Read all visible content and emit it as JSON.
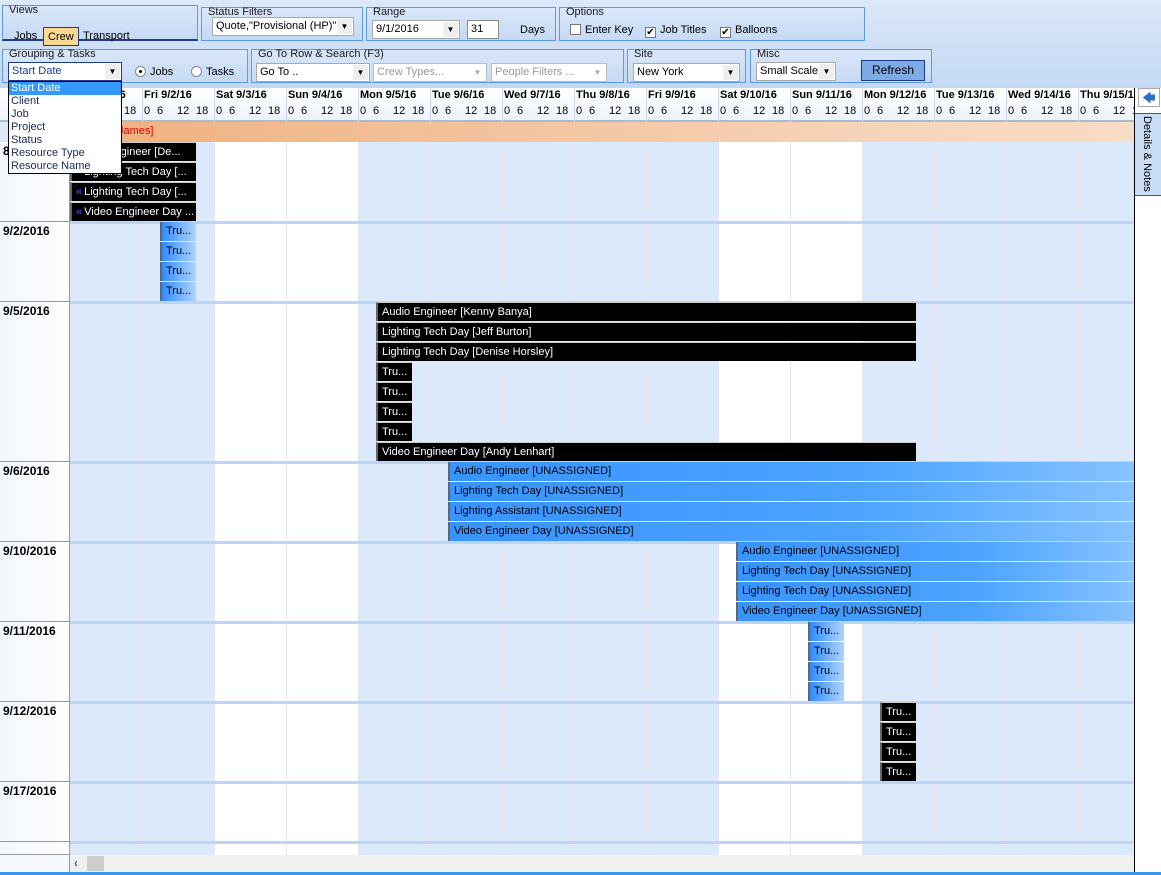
{
  "views": {
    "title": "Views",
    "tabs": [
      {
        "label": "Jobs",
        "active": false
      },
      {
        "label": "Crew",
        "active": true
      },
      {
        "label": "Transport",
        "active": false
      }
    ]
  },
  "status_filters": {
    "title": "Status Filters",
    "value": "Quote,\"Provisional (HP)\","
  },
  "range": {
    "title": "Range",
    "start_date": "9/1/2016",
    "days_value": "31",
    "days_label": "Days"
  },
  "options": {
    "title": "Options",
    "items": [
      {
        "label": "Enter Key",
        "checked": false
      },
      {
        "label": "Job Titles",
        "checked": true
      },
      {
        "label": "Balloons",
        "checked": true
      }
    ]
  },
  "grouping": {
    "title": "Grouping & Tasks",
    "value": "Start Date",
    "radios": [
      {
        "label": "Jobs",
        "selected": true
      },
      {
        "label": "Tasks",
        "selected": false
      }
    ],
    "dropdown_options": [
      "Start Date",
      "Client",
      "Job",
      "Project",
      "Status",
      "Resource Type",
      "Resource Name"
    ],
    "dropdown_selected": "Start Date"
  },
  "goto": {
    "title": "Go To Row & Search (F3)",
    "goto_value": "Go To ..",
    "crew_types_placeholder": "Crew Types...",
    "people_filters_placeholder": "People Filters ..."
  },
  "site": {
    "title": "Site",
    "value": "New York"
  },
  "misc": {
    "title": "Misc",
    "scale_value": "Small Scale",
    "refresh_label": "Refresh"
  },
  "side_panel": {
    "tab_label": "Details & Notes"
  },
  "timeline": {
    "view_start": "2016-09-01",
    "hour_ticks": [
      "0",
      "6",
      "12",
      "18"
    ],
    "days": [
      {
        "label": "Thu 9/1/16",
        "weekend": false
      },
      {
        "label": "Fri 9/2/16",
        "weekend": false
      },
      {
        "label": "Sat 9/3/16",
        "weekend": true
      },
      {
        "label": "Sun 9/4/16",
        "weekend": true
      },
      {
        "label": "Mon 9/5/16",
        "weekend": false
      },
      {
        "label": "Tue 9/6/16",
        "weekend": false
      },
      {
        "label": "Wed 9/7/16",
        "weekend": false
      },
      {
        "label": "Thu 9/8/16",
        "weekend": false
      },
      {
        "label": "Fri 9/9/16",
        "weekend": false
      },
      {
        "label": "Sat 9/10/16",
        "weekend": true
      },
      {
        "label": "Sun 9/11/16",
        "weekend": true
      },
      {
        "label": "Mon 9/12/16",
        "weekend": false
      },
      {
        "label": "Tue 9/13/16",
        "weekend": false
      },
      {
        "label": "Wed 9/14/16",
        "weekend": false
      },
      {
        "label": "Thu 9/15/16",
        "weekend": false
      }
    ]
  },
  "summary_row": {
    "text": "James]"
  },
  "colors": {
    "black_bar": "#000000",
    "unassigned_bar": "#3894ff",
    "weekday_bg": "#dbe9fa",
    "weekend_bg": "#ffffff",
    "summary_row": "#efb07e",
    "summary_text": "#e00000"
  },
  "groups": [
    {
      "label": "8",
      "rows": 4,
      "bars": [
        {
          "text": "Audio Engineer [De...",
          "style": "black",
          "start": "2016-09-01 00:00",
          "end": "2016-09-02 18:00",
          "continues_left": false
        },
        {
          "text": "Lighting Tech Day [...",
          "style": "black",
          "start": "2016-09-01 00:00",
          "end": "2016-09-02 18:00",
          "continues_left": true
        },
        {
          "text": "Lighting Tech Day [...",
          "style": "black",
          "start": "2016-09-01 00:00",
          "end": "2016-09-02 18:00",
          "continues_left": true
        },
        {
          "text": "Video Engineer Day ...",
          "style": "black",
          "start": "2016-09-01 00:00",
          "end": "2016-09-02 18:00",
          "continues_left": true
        }
      ]
    },
    {
      "label": "9/2/2016",
      "rows": 4,
      "bars": [
        {
          "text": "Tru...",
          "style": "tru-blue",
          "start": "2016-09-02 06:00",
          "end": "2016-09-02 18:00"
        },
        {
          "text": "Tru...",
          "style": "tru-blue",
          "start": "2016-09-02 06:00",
          "end": "2016-09-02 18:00"
        },
        {
          "text": "Tru...",
          "style": "tru-blue",
          "start": "2016-09-02 06:00",
          "end": "2016-09-02 18:00"
        },
        {
          "text": "Tru...",
          "style": "tru-blue",
          "start": "2016-09-02 06:00",
          "end": "2016-09-02 18:00"
        }
      ]
    },
    {
      "label": "9/5/2016",
      "rows": 8,
      "bars": [
        {
          "text": "Audio Engineer [Kenny Banya]",
          "style": "black",
          "start": "2016-09-05 06:00",
          "end": "2016-09-12 18:00"
        },
        {
          "text": "Lighting Tech Day [Jeff Burton]",
          "style": "black",
          "start": "2016-09-05 06:00",
          "end": "2016-09-12 18:00"
        },
        {
          "text": "Lighting Tech Day [Denise Horsley]",
          "style": "black",
          "start": "2016-09-05 06:00",
          "end": "2016-09-12 18:00"
        },
        {
          "text": "Tru...",
          "style": "black",
          "start": "2016-09-05 06:00",
          "end": "2016-09-05 18:00"
        },
        {
          "text": "Tru...",
          "style": "black",
          "start": "2016-09-05 06:00",
          "end": "2016-09-05 18:00"
        },
        {
          "text": "Tru...",
          "style": "black",
          "start": "2016-09-05 06:00",
          "end": "2016-09-05 18:00"
        },
        {
          "text": "Tru...",
          "style": "black",
          "start": "2016-09-05 06:00",
          "end": "2016-09-05 18:00"
        },
        {
          "text": "Video Engineer Day [Andy Lenhart]",
          "style": "black",
          "start": "2016-09-05 06:00",
          "end": "2016-09-12 18:00"
        }
      ]
    },
    {
      "label": "9/6/2016",
      "rows": 4,
      "bars": [
        {
          "text": "Audio Engineer [UNASSIGNED]",
          "style": "blue",
          "start": "2016-09-06 06:00",
          "end": "2016-09-16 00:00"
        },
        {
          "text": "Lighting Tech Day [UNASSIGNED]",
          "style": "blue",
          "start": "2016-09-06 06:00",
          "end": "2016-09-16 00:00"
        },
        {
          "text": "Lighting Assistant [UNASSIGNED]",
          "style": "blue",
          "start": "2016-09-06 06:00",
          "end": "2016-09-16 00:00"
        },
        {
          "text": "Video Engineer Day [UNASSIGNED]",
          "style": "blue",
          "start": "2016-09-06 06:00",
          "end": "2016-09-16 00:00"
        }
      ]
    },
    {
      "label": "9/10/2016",
      "rows": 4,
      "bars": [
        {
          "text": "Audio Engineer [UNASSIGNED]",
          "style": "blue",
          "start": "2016-09-10 06:00",
          "end": "2016-09-16 00:00"
        },
        {
          "text": "Lighting Tech Day [UNASSIGNED]",
          "style": "blue",
          "start": "2016-09-10 06:00",
          "end": "2016-09-16 00:00"
        },
        {
          "text": "Lighting Tech Day [UNASSIGNED]",
          "style": "blue",
          "start": "2016-09-10 06:00",
          "end": "2016-09-16 00:00"
        },
        {
          "text": "Video Engineer Day [UNASSIGNED]",
          "style": "blue",
          "start": "2016-09-10 06:00",
          "end": "2016-09-16 00:00"
        }
      ]
    },
    {
      "label": "9/11/2016",
      "rows": 4,
      "bars": [
        {
          "text": "Tru...",
          "style": "tru-blue",
          "start": "2016-09-11 06:00",
          "end": "2016-09-11 18:00"
        },
        {
          "text": "Tru...",
          "style": "tru-blue",
          "start": "2016-09-11 06:00",
          "end": "2016-09-11 18:00"
        },
        {
          "text": "Tru...",
          "style": "tru-blue",
          "start": "2016-09-11 06:00",
          "end": "2016-09-11 18:00"
        },
        {
          "text": "Tru...",
          "style": "tru-blue",
          "start": "2016-09-11 06:00",
          "end": "2016-09-11 18:00"
        }
      ]
    },
    {
      "label": "9/12/2016",
      "rows": 4,
      "bars": [
        {
          "text": "Tru...",
          "style": "black",
          "start": "2016-09-12 06:00",
          "end": "2016-09-12 18:00"
        },
        {
          "text": "Tru...",
          "style": "black",
          "start": "2016-09-12 06:00",
          "end": "2016-09-12 18:00"
        },
        {
          "text": "Tru...",
          "style": "black",
          "start": "2016-09-12 06:00",
          "end": "2016-09-12 18:00"
        },
        {
          "text": "Tru...",
          "style": "black",
          "start": "2016-09-12 06:00",
          "end": "2016-09-12 18:00"
        }
      ]
    },
    {
      "label": "9/17/2016",
      "rows": 3,
      "bars": []
    }
  ]
}
